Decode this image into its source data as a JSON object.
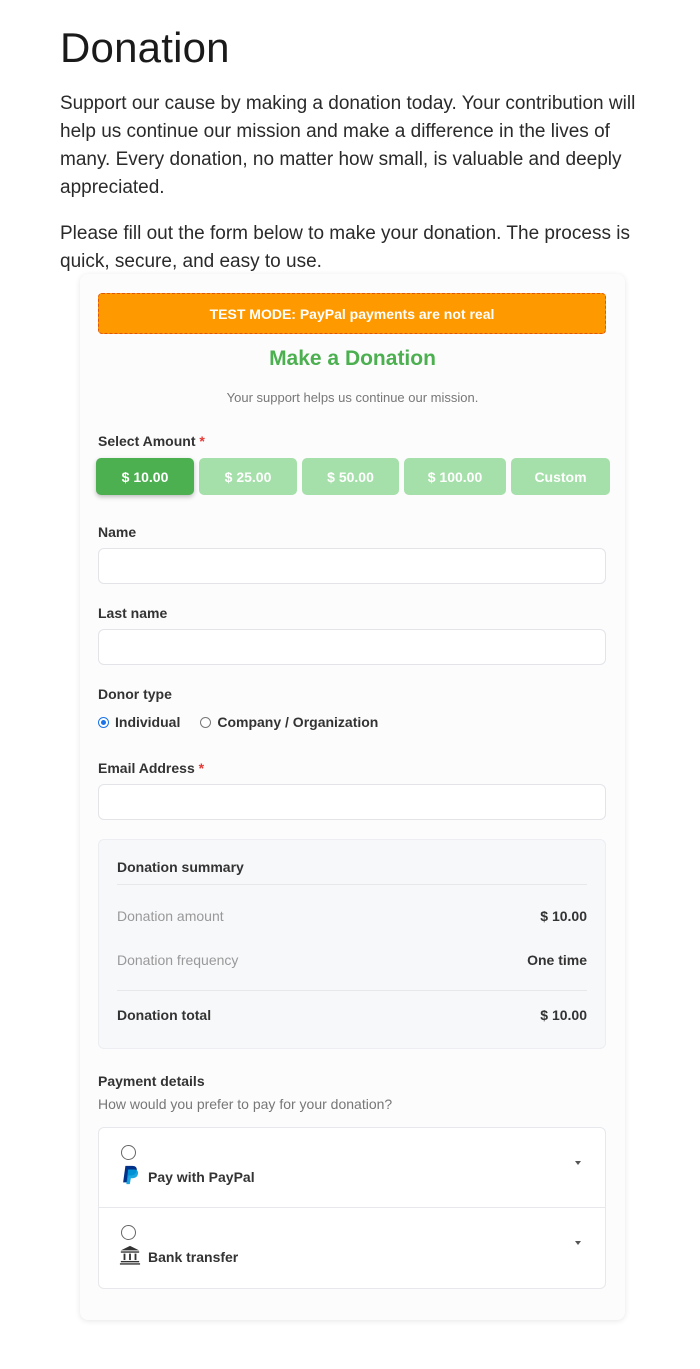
{
  "page": {
    "title": "Donation",
    "intro_1": "Support our cause by making a donation today. Your contribution will help us continue our mission and make a difference in the lives of many. Every donation, no matter how small, is valuable and deeply appreciated.",
    "intro_2": "Please fill out the form below to make your donation. The process is quick, secure, and easy to use."
  },
  "form": {
    "test_banner": "TEST MODE: PayPal payments are not real",
    "heading": "Make a Donation",
    "subheading": "Your support helps us continue our mission.",
    "amount": {
      "label": "Select Amount",
      "required_mark": "*",
      "options": [
        "$ 10.00",
        "$ 25.00",
        "$ 50.00",
        "$ 100.00",
        "Custom"
      ],
      "selected_index": 0
    },
    "name": {
      "label": "Name",
      "value": "",
      "placeholder": ""
    },
    "last_name": {
      "label": "Last name",
      "value": "",
      "placeholder": ""
    },
    "donor_type": {
      "label": "Donor type",
      "options": [
        "Individual",
        "Company / Organization"
      ],
      "selected_index": 0
    },
    "email": {
      "label": "Email Address",
      "required_mark": "*",
      "value": "",
      "placeholder": ""
    },
    "summary": {
      "title": "Donation summary",
      "amount_label": "Donation amount",
      "amount_value": "$ 10.00",
      "frequency_label": "Donation frequency",
      "frequency_value": "One time",
      "total_label": "Donation total",
      "total_value": "$ 10.00"
    },
    "payment": {
      "title": "Payment details",
      "subtitle": "How would you prefer to pay for your donation?",
      "options": [
        {
          "label": "Pay with PayPal",
          "icon": "paypal-icon"
        },
        {
          "label": "Bank transfer",
          "icon": "bank-icon"
        }
      ]
    }
  },
  "colors": {
    "accent_green": "#4caf50",
    "light_green": "#a5dfa9",
    "banner_orange": "#ff9900",
    "required_red": "#e53935",
    "paypal_dark": "#003087",
    "paypal_light": "#009cde"
  }
}
